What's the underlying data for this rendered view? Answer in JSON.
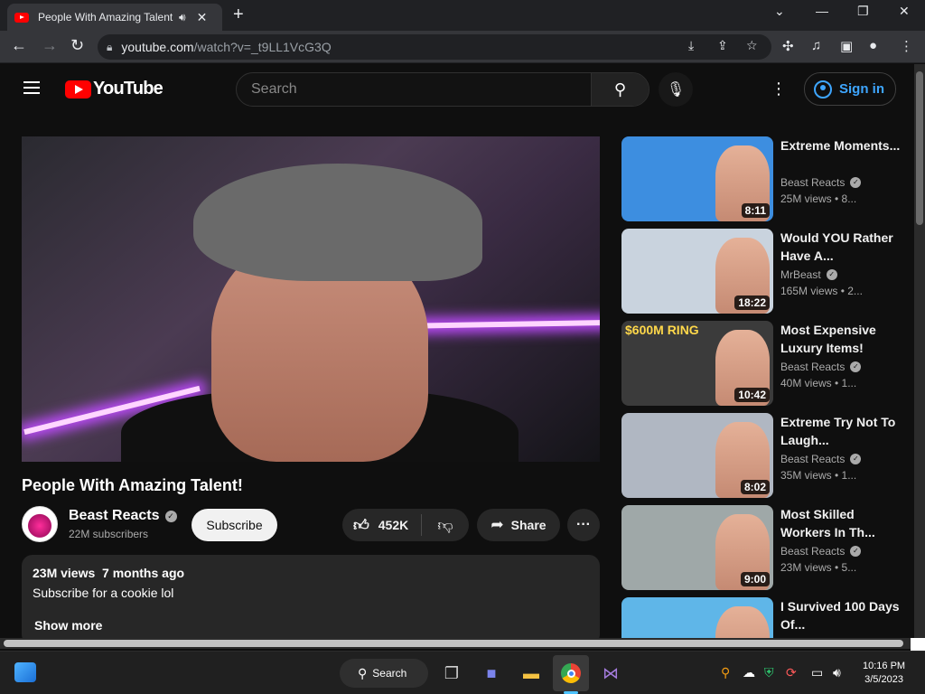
{
  "browser": {
    "tab_title": "People With Amazing Talent! - YouTube",
    "url_host": "youtube.com",
    "url_path": "/watch?v=_t9LL1VcG3Q"
  },
  "header": {
    "logo_text": "YouTube",
    "search_placeholder": "Search",
    "signin_label": "Sign in"
  },
  "video": {
    "title": "People With Amazing Talent!",
    "channel": "Beast Reacts",
    "subscribers": "22M subscribers",
    "subscribe_label": "Subscribe",
    "likes": "452K",
    "share_label": "Share",
    "views_date": "23M views  7 months ago",
    "description": "Subscribe for a cookie lol",
    "show_more": "Show more"
  },
  "recommendations": [
    {
      "title": "Extreme Moments...",
      "channel": "Beast Reacts",
      "stats": "25M views • 8...",
      "duration": "8:11",
      "thumb_color": "#3d8ee0",
      "badge": ""
    },
    {
      "title": "Would YOU Rather Have A...",
      "channel": "MrBeast",
      "stats": "165M views • 2...",
      "duration": "18:22",
      "thumb_color": "#c9d3de",
      "badge": ""
    },
    {
      "title": "Most Expensive Luxury Items!",
      "channel": "Beast Reacts",
      "stats": "40M views • 1...",
      "duration": "10:42",
      "thumb_color": "#3b3b3b",
      "badge": "$600M RING"
    },
    {
      "title": "Extreme Try Not To Laugh...",
      "channel": "Beast Reacts",
      "stats": "35M views • 1...",
      "duration": "8:02",
      "thumb_color": "#b0b7c2",
      "badge": ""
    },
    {
      "title": "Most Skilled Workers In Th...",
      "channel": "Beast Reacts",
      "stats": "23M views • 5...",
      "duration": "9:00",
      "thumb_color": "#9fa8a8",
      "badge": ""
    },
    {
      "title": "I Survived 100 Days Of...",
      "channel": "",
      "stats": "",
      "duration": "",
      "thumb_color": "#5fb6e8",
      "badge": ""
    }
  ],
  "taskbar": {
    "search_label": "Search",
    "time": "10:16 PM",
    "date": "3/5/2023"
  }
}
